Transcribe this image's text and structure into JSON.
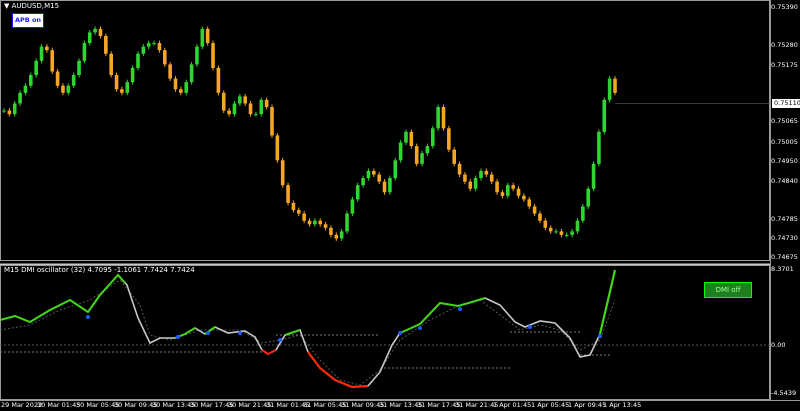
{
  "main_chart": {
    "title": "AUDUSD,M15",
    "button_label": "APB on",
    "current_price": "0.75110",
    "y_labels": [
      "0.75390",
      "0.75280",
      "0.75175",
      "0.75065",
      "0.75005",
      "0.74950",
      "0.74840",
      "0.74785",
      "0.74730",
      "0.74675"
    ]
  },
  "oscillator": {
    "title": "M15 DMI oscillator (32) 4.7095 -1.1061 7.7424 7.7424",
    "button_label": "DMI off",
    "y_labels": [
      "8.3701",
      "0.00",
      "-4.5439"
    ]
  },
  "x_axis": {
    "labels": [
      "29 Mar 2022",
      "30 Mar 01:45",
      "30 Mar 05:45",
      "30 Mar 09:45",
      "30 Mar 13:45",
      "30 Mar 17:45",
      "30 Mar 21:45",
      "31 Mar 01:45",
      "31 Mar 05:45",
      "31 Mar 09:45",
      "31 Mar 13:45",
      "31 Mar 17:45",
      "31 Mar 21:45",
      "1 Apr 01:45",
      "1 Apr 05:45",
      "1 Apr 09:45",
      "1 Apr 13:45"
    ]
  },
  "chart_data": {
    "type": "line",
    "title": "AUDUSD,M15",
    "series": [
      {
        "name": "AUDUSD",
        "values": [
          0.7509,
          0.7508,
          0.7511,
          0.7514,
          0.7516,
          0.7519,
          0.7523,
          0.7527,
          0.7526,
          0.752,
          0.7516,
          0.7514,
          0.7516,
          0.7519,
          0.7523,
          0.7528,
          0.7531,
          0.7532,
          0.753,
          0.7525,
          0.7519,
          0.7515,
          0.7514,
          0.7517,
          0.7521,
          0.7525,
          0.7527,
          0.7528,
          0.7528,
          0.7526,
          0.7522,
          0.7518,
          0.7515,
          0.7514,
          0.7517,
          0.7522,
          0.7527,
          0.7532,
          0.7528,
          0.7521,
          0.7514,
          0.7509,
          0.7508,
          0.7511,
          0.7513,
          0.7511,
          0.7508,
          0.7508,
          0.7512,
          0.751,
          0.7502,
          0.7495,
          0.7488,
          0.7483,
          0.7481,
          0.748,
          0.7478,
          0.7477,
          0.7478,
          0.7477,
          0.7476,
          0.7474,
          0.7473,
          0.7475,
          0.748,
          0.7484,
          0.7488,
          0.749,
          0.7492,
          0.7491,
          0.7489,
          0.7486,
          0.749,
          0.7495,
          0.75,
          0.7503,
          0.7499,
          0.7494,
          0.7497,
          0.7499,
          0.7504,
          0.751,
          0.7504,
          0.7498,
          0.7494,
          0.7491,
          0.7489,
          0.7487,
          0.749,
          0.7492,
          0.7491,
          0.7489,
          0.7486,
          0.7485,
          0.7488,
          0.7487,
          0.7485,
          0.7484,
          0.7482,
          0.748,
          0.7478,
          0.7476,
          0.7475,
          0.7475,
          0.7474,
          0.7474,
          0.7475,
          0.7478,
          0.7482,
          0.7487,
          0.7494,
          0.7503,
          0.7512,
          0.7518,
          0.7514
        ]
      }
    ],
    "ylim": [
      0.74675,
      0.7539
    ]
  }
}
